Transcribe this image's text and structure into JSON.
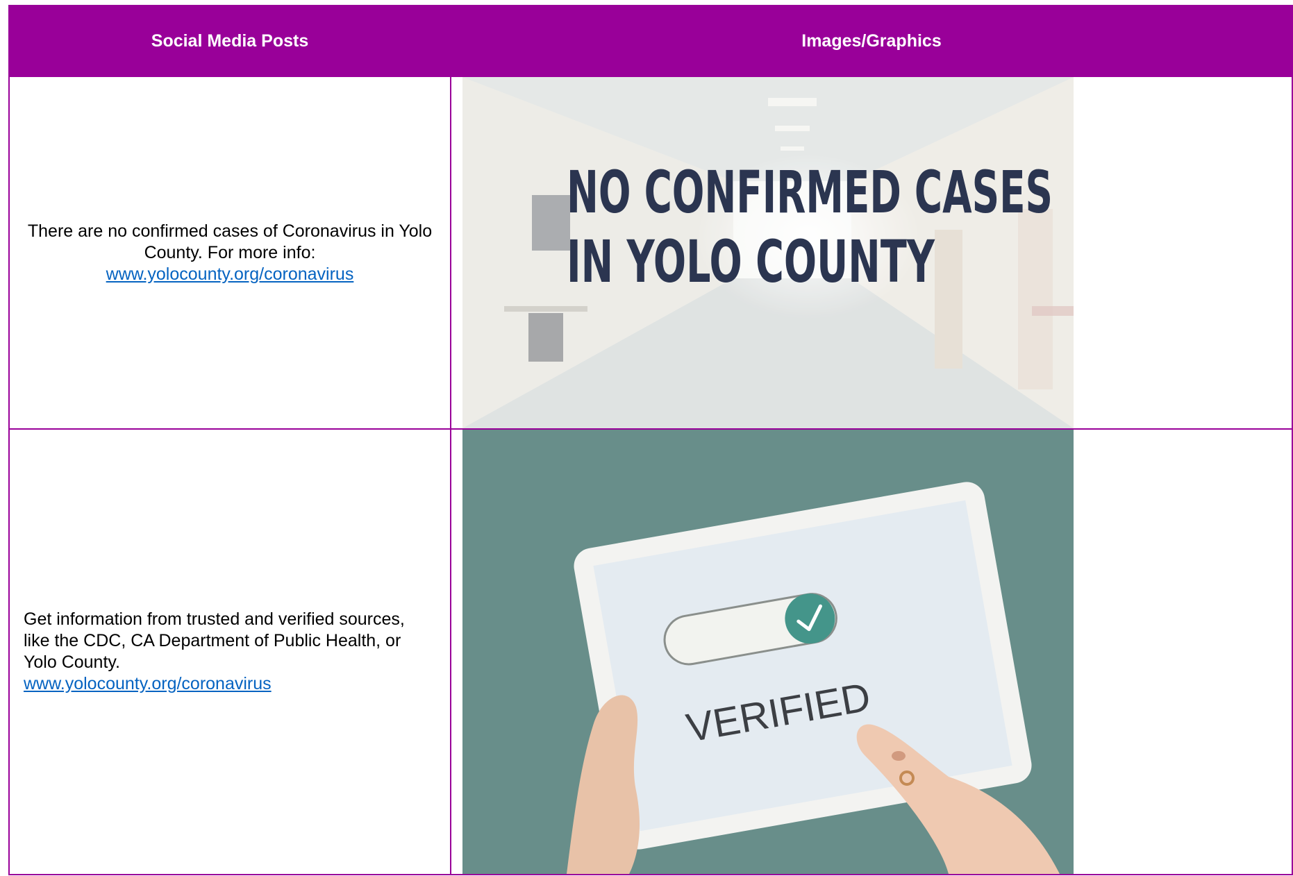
{
  "table": {
    "headers": [
      "Social Media Posts",
      "Images/Graphics"
    ],
    "rows": [
      {
        "post_text": "There are no confirmed cases of Coronavirus in Yolo County. For more info:",
        "link": "www.yolocounty.org/coronavirus",
        "graphic": {
          "line1": "NO CONFIRMED CASES",
          "line2": "IN YOLO COUNTY"
        }
      },
      {
        "post_text": "Get information from trusted and verified sources, like the CDC, CA Department of Public Health, or Yolo County.",
        "link": "www.yolocounty.org/coronavirus",
        "graphic": {
          "label": "VERIFIED"
        }
      }
    ]
  },
  "colors": {
    "header_bg": "#990099",
    "border": "#990099",
    "link": "#0563c1"
  }
}
